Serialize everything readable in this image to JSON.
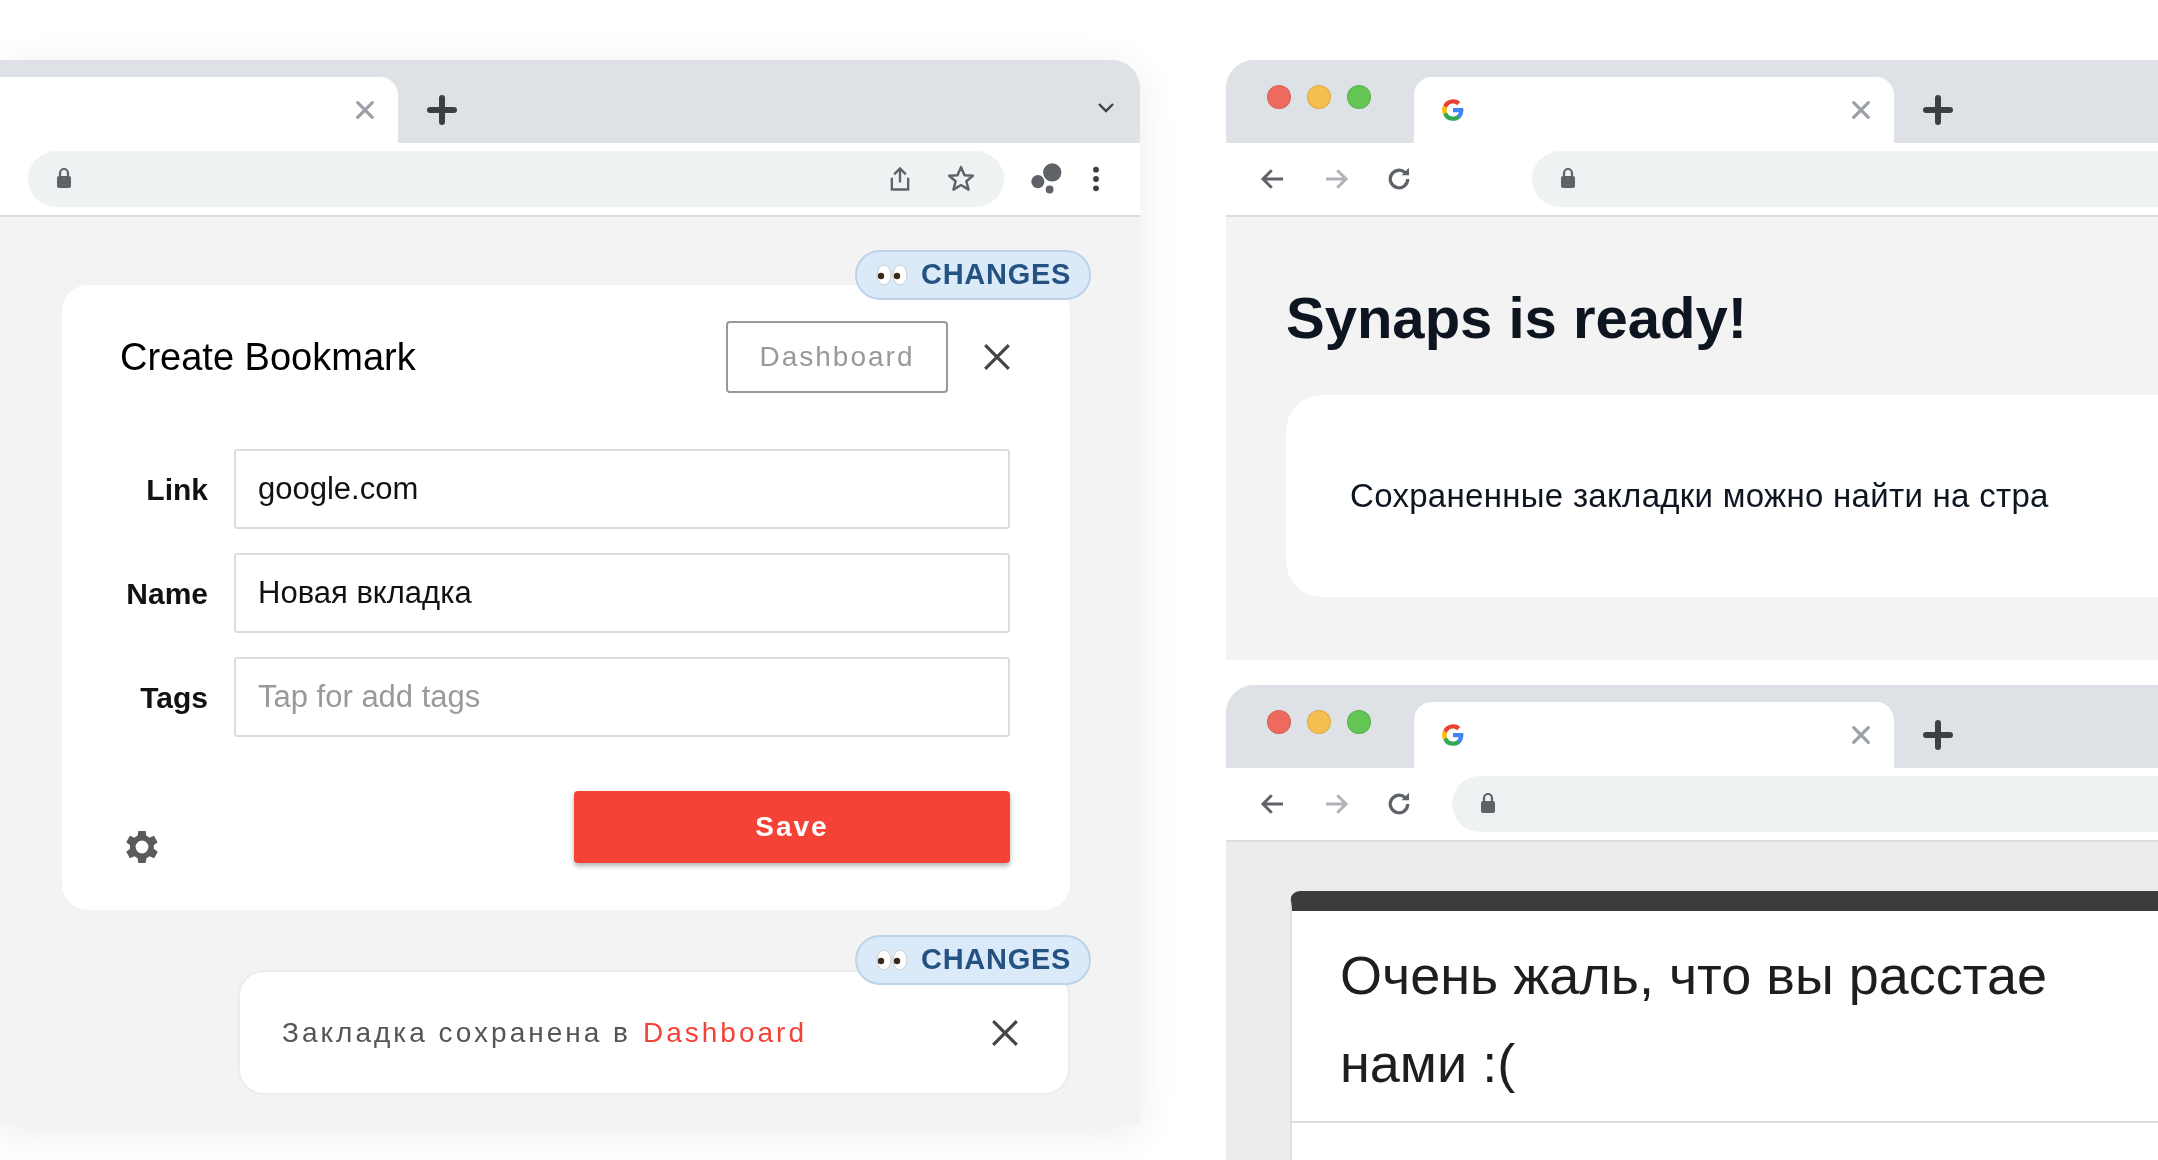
{
  "left_browser": {
    "bookmark_form": {
      "badge": "CHANGES",
      "title": "Create Bookmark",
      "dashboard_button": "Dashboard",
      "fields": [
        {
          "label": "Link",
          "value": "google.com"
        },
        {
          "label": "Name",
          "value": "Новая вкладка"
        },
        {
          "label": "Tags",
          "placeholder": "Tap for add tags"
        }
      ],
      "save_button": "Save"
    },
    "toast": {
      "badge": "CHANGES",
      "message": "Закладка сохранена в",
      "link": "Dashboard"
    }
  },
  "right_top_browser": {
    "heading": "Synaps is ready!",
    "card_text": "Сохраненные закладки можно найти на стра"
  },
  "right_bottom_browser": {
    "message_lines": [
      "Очень жаль, что вы расстае",
      "нами :("
    ]
  }
}
